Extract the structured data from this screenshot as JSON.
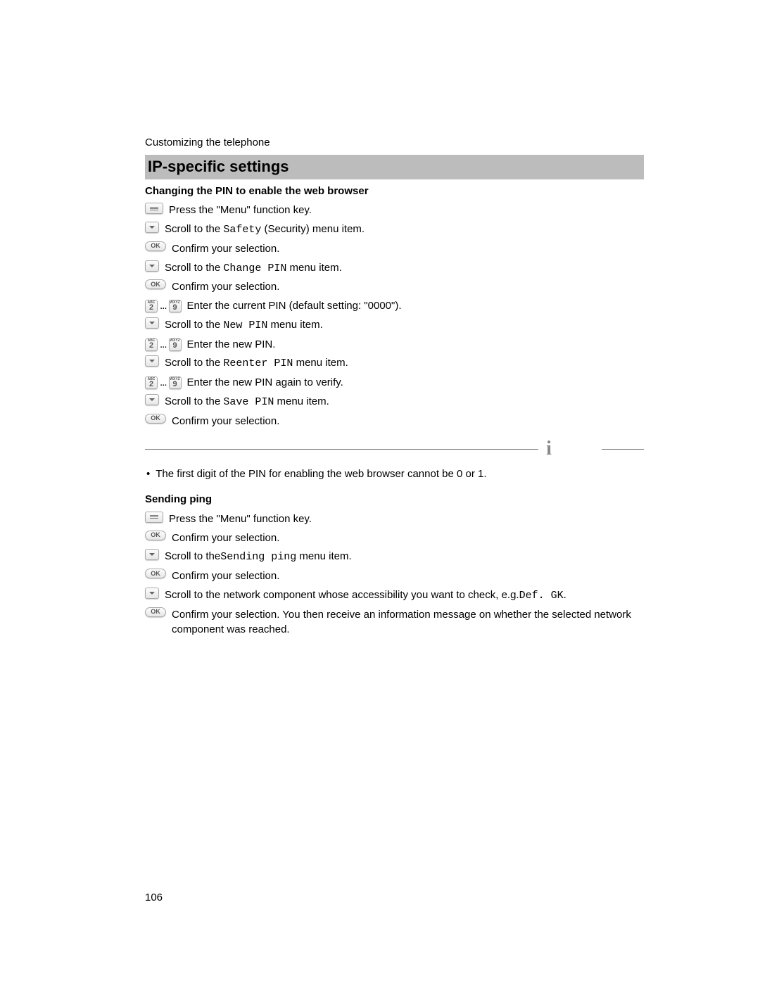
{
  "breadcrumb": "Customizing the telephone",
  "section_title": "IP-specific settings",
  "sub1_title": "Changing the PIN to enable the web browser",
  "steps1": [
    {
      "icon": "menu",
      "pre": "Press the \"Menu\" function key."
    },
    {
      "icon": "down",
      "pre": "Scroll to the ",
      "mono": "Safety",
      "post": " (Security) menu item."
    },
    {
      "icon": "ok",
      "pre": "Confirm your selection."
    },
    {
      "icon": "down",
      "pre": "Scroll to the ",
      "mono": "Change PIN",
      "post": " menu item."
    },
    {
      "icon": "ok",
      "pre": "Confirm your selection."
    },
    {
      "icon": "keys",
      "pre": "Enter the current PIN (default setting: \"0000\")."
    },
    {
      "icon": "down",
      "pre": "Scroll to the ",
      "mono": "New PIN",
      "post": " menu item."
    },
    {
      "icon": "keys",
      "pre": "Enter the new PIN."
    },
    {
      "icon": "down",
      "pre": "Scroll to the ",
      "mono": "Reenter PIN",
      "post": " menu item."
    },
    {
      "icon": "keys",
      "pre": "Enter the new PIN again to verify."
    },
    {
      "icon": "down",
      "pre": "Scroll to the ",
      "mono": "Save PIN",
      "post": " menu item."
    },
    {
      "icon": "ok",
      "pre": "Confirm your selection."
    }
  ],
  "note1": "The first digit of the PIN for enabling the web browser cannot be 0 or 1.",
  "sub2_title": "Sending ping",
  "steps2": [
    {
      "icon": "menu",
      "pre": "Press the \"Menu\" function key."
    },
    {
      "icon": "ok",
      "pre": "Confirm your selection."
    },
    {
      "icon": "down",
      "pre": "Scroll to the",
      "mono": "Sending ping",
      "post": " menu item."
    },
    {
      "icon": "ok",
      "pre": "Confirm your selection."
    },
    {
      "icon": "down",
      "pre": "Scroll to the network component whose accessibility you want to check, e.g.",
      "mono": "Def. GK",
      "post": "."
    },
    {
      "icon": "ok",
      "pre": "Confirm your selection. You then receive an information message on whether the selected network component was reached."
    }
  ],
  "keys": {
    "k2": "2",
    "k2s": "ABC",
    "k9": "9",
    "k9s": "WXYZ",
    "ellipsis": " ... "
  },
  "info_glyph": "i",
  "page_number": "106"
}
